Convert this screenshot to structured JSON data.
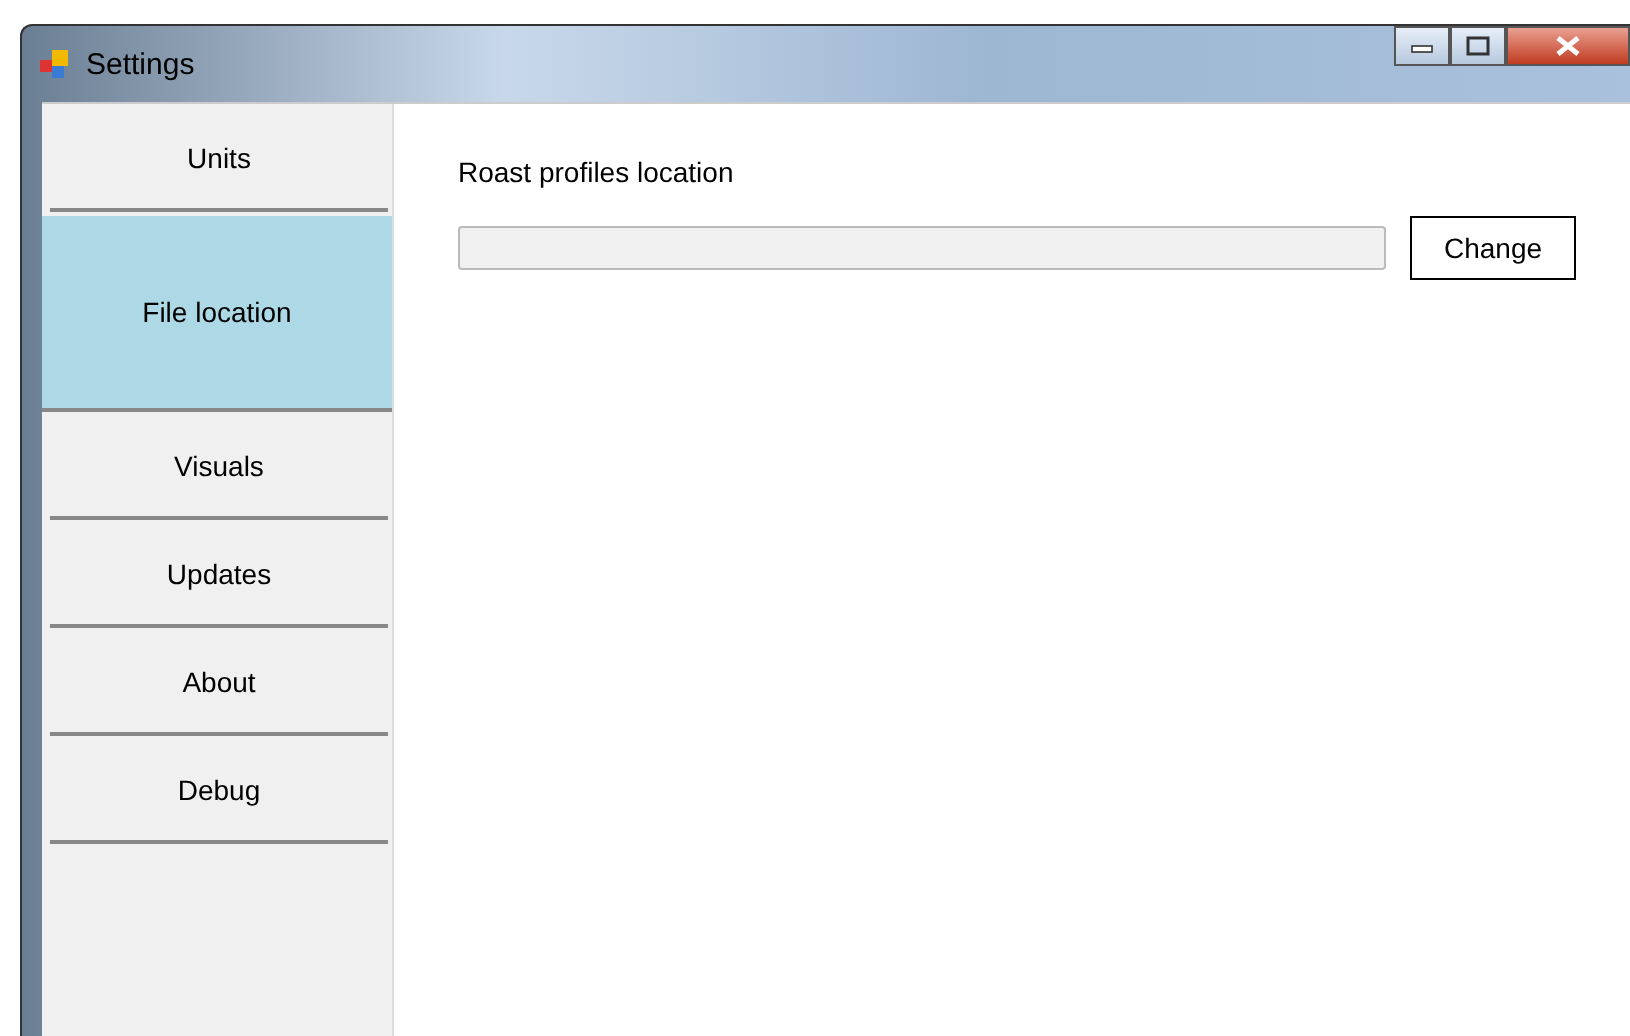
{
  "window": {
    "title": "Settings"
  },
  "tabs": [
    {
      "label": "Units",
      "selected": false
    },
    {
      "label": "File location",
      "selected": true
    },
    {
      "label": "Visuals",
      "selected": false
    },
    {
      "label": "Updates",
      "selected": false
    },
    {
      "label": "About",
      "selected": false
    },
    {
      "label": "Debug",
      "selected": false
    }
  ],
  "content": {
    "label": "Roast profiles location",
    "button": "Change"
  }
}
